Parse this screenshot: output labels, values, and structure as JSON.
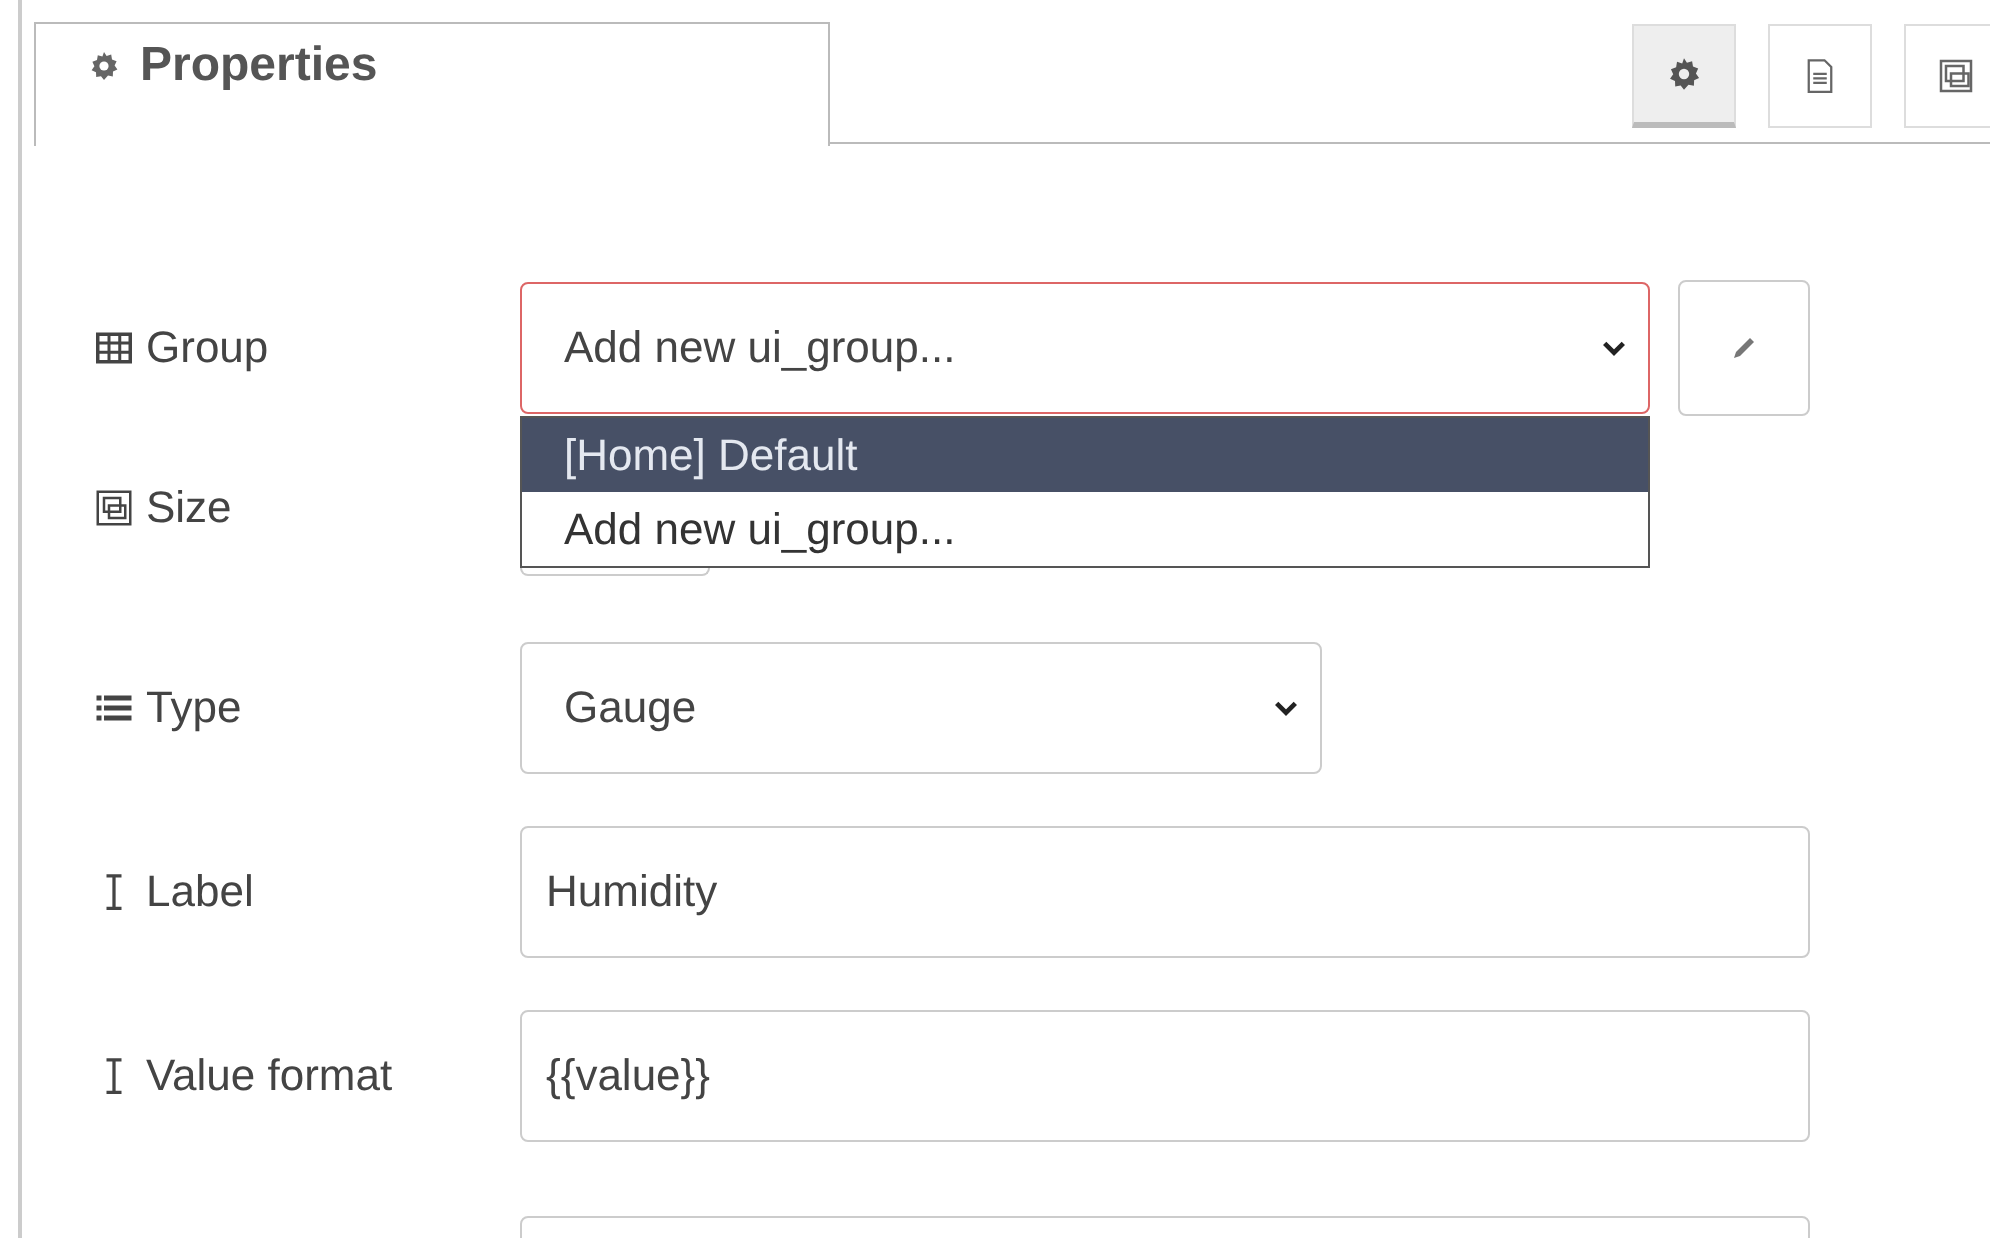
{
  "tabs": [
    {
      "label": "Properties",
      "selected": true
    }
  ],
  "toolbar": [
    {
      "kind": "gear",
      "selected": true
    },
    {
      "kind": "document",
      "selected": false
    },
    {
      "kind": "frame",
      "selected": false
    }
  ],
  "rows": [
    {
      "kind": "group",
      "label": "Group",
      "value": "Add new ui_group...",
      "invalid": true,
      "edit_button": true,
      "dropdown": [
        {
          "label": "[Home] Default",
          "highlighted": true
        },
        {
          "label": "Add new ui_group...",
          "highlighted": false
        }
      ]
    },
    {
      "kind": "size",
      "label": "Size"
    },
    {
      "kind": "type",
      "label": "Type",
      "value": "Gauge",
      "invalid": false
    },
    {
      "kind": "text",
      "label": "Label",
      "value": "Humidity"
    },
    {
      "kind": "text",
      "label": "Value format",
      "value": "{{value}}"
    },
    {
      "kind": "text-cut"
    }
  ]
}
